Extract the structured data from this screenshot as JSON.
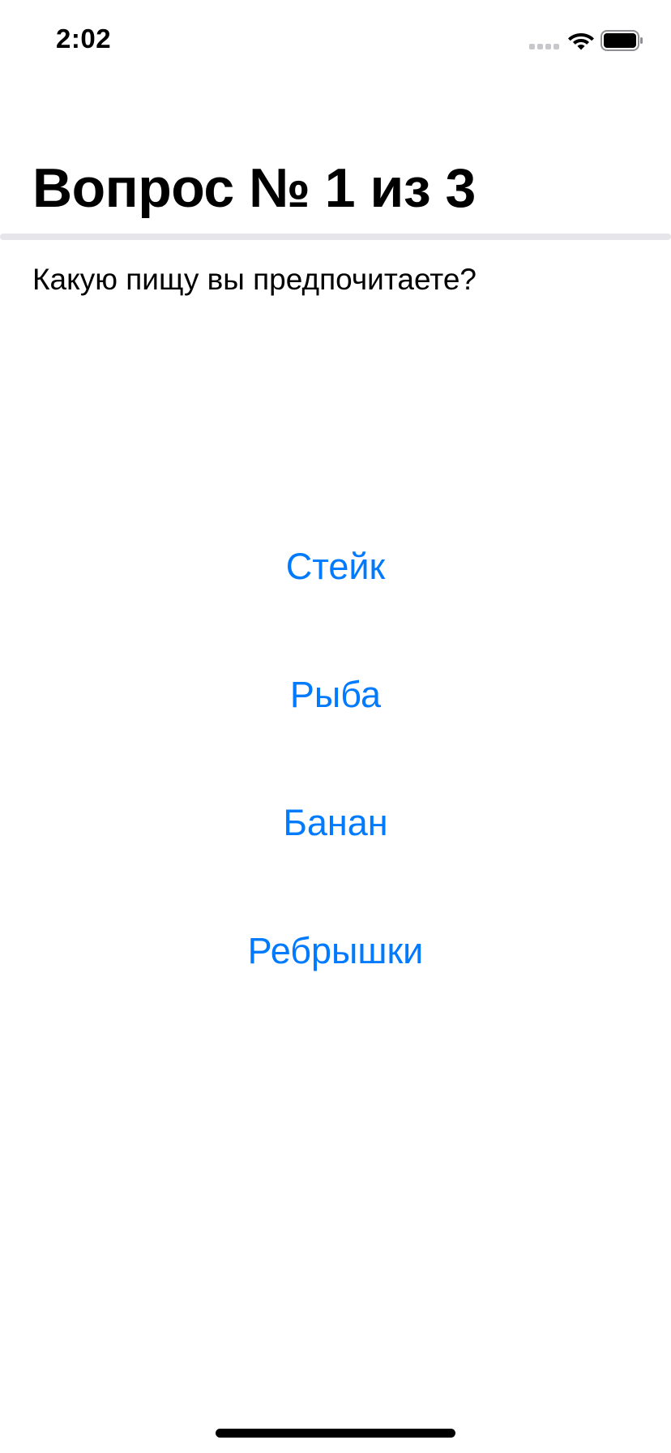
{
  "status_bar": {
    "time": "2:02",
    "icons": [
      "signal-icon",
      "wifi-icon",
      "battery-icon"
    ]
  },
  "quiz": {
    "title": "Вопрос № 1 из 3",
    "progress": 0.0,
    "question": "Какую пищу вы предпочитаете?",
    "answers": [
      "Стейк",
      "Рыба",
      "Банан",
      "Ребрышки"
    ]
  },
  "colors": {
    "accent": "#007aff",
    "text": "#000000",
    "background": "#ffffff",
    "track": "#e5e5ea"
  }
}
